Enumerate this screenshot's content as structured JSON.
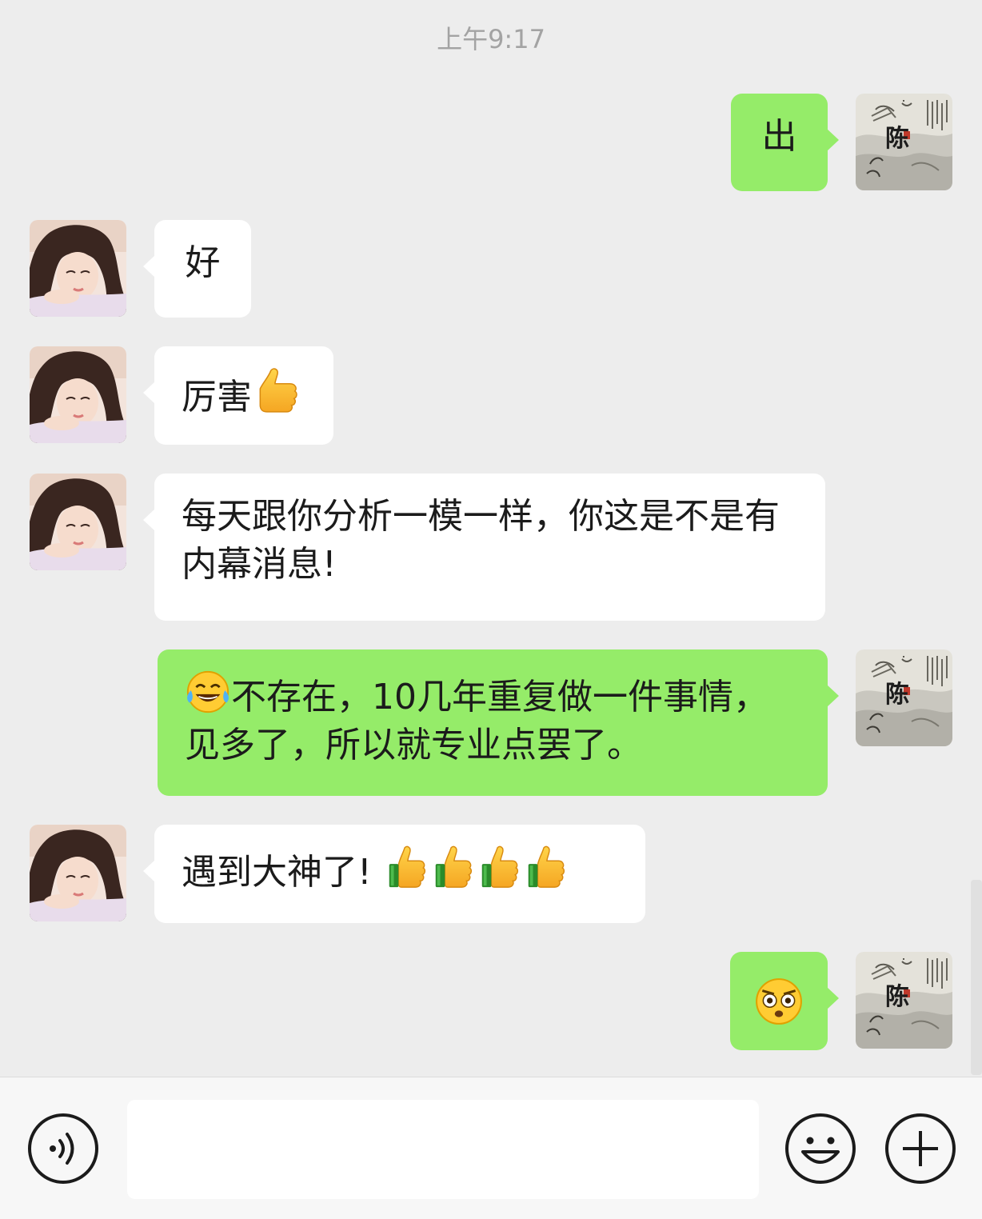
{
  "header": {
    "timestamp": "上午9:17"
  },
  "messages": [
    {
      "sender": "me",
      "text": "出"
    },
    {
      "sender": "contact",
      "text": "好"
    },
    {
      "sender": "contact",
      "text": "厉害",
      "emoji": "thumbs-up"
    },
    {
      "sender": "contact",
      "text": "每天跟你分析一模一样，你这是不是有内幕消息!"
    },
    {
      "sender": "me",
      "text": "不存在，10几年重复做一件事情，见多了，所以就专业点罢了。",
      "emoji": "tears-of-joy"
    },
    {
      "sender": "contact",
      "text": "遇到大神了! ",
      "emoji": "thumbs-up x4"
    },
    {
      "sender": "me",
      "emoji": "wide-eyed-face"
    }
  ],
  "my_avatar": {
    "character": "陈"
  },
  "input": {
    "placeholder": ""
  },
  "icons": [
    "voice-icon",
    "emoji-face-icon",
    "plus-icon"
  ],
  "colors": {
    "background": "#ededed",
    "outgoing_bubble": "#95ec69",
    "incoming_bubble": "#ffffff"
  }
}
